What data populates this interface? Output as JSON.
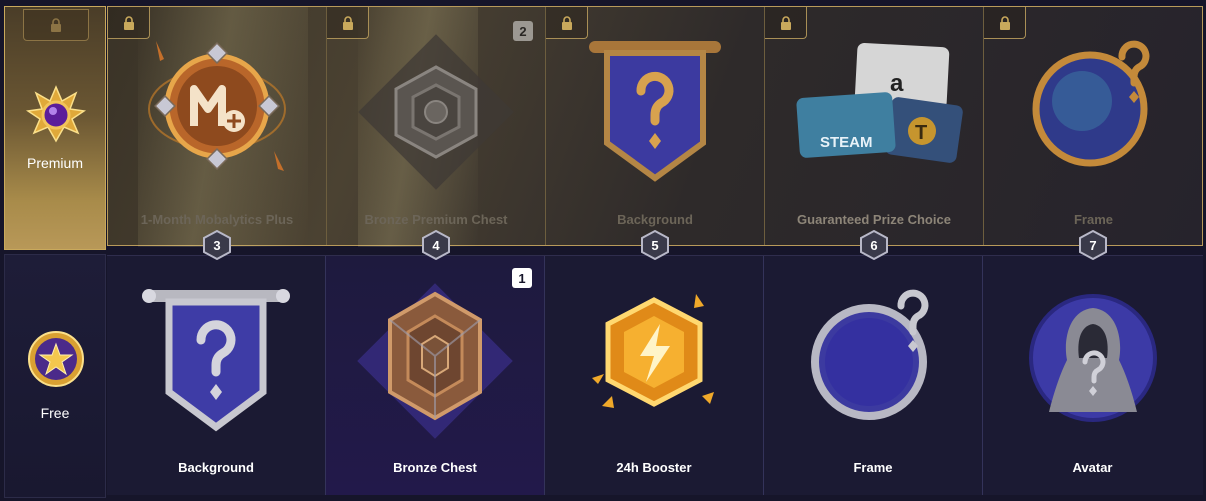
{
  "sidebar": {
    "premium": {
      "label": "Premium",
      "lock_icon": "lock-icon",
      "icon": "premium-crest-icon"
    },
    "free": {
      "label": "Free",
      "icon": "star-medal-icon"
    }
  },
  "levels": [
    "3",
    "4",
    "5",
    "6",
    "7"
  ],
  "premium_rewards": [
    {
      "name": "1-Month Mobalytics Plus",
      "locked": true,
      "icon": "mobalytics-plus-medallion"
    },
    {
      "name": "Bronze Premium Chest",
      "locked": true,
      "count": "2",
      "icon": "bronze-chest"
    },
    {
      "name": "Background",
      "locked": true,
      "icon": "banner-question"
    },
    {
      "name": "Guaranteed Prize Choice",
      "locked": true,
      "icon": "gift-cards",
      "card_labels": [
        "a",
        "STEAM",
        "T"
      ]
    },
    {
      "name": "Frame",
      "locked": true,
      "icon": "frame-question"
    }
  ],
  "free_rewards": [
    {
      "name": "Background",
      "icon": "banner-question"
    },
    {
      "name": "Bronze Chest",
      "count": "1",
      "icon": "bronze-chest"
    },
    {
      "name": "24h Booster",
      "icon": "lightning-hex"
    },
    {
      "name": "Frame",
      "icon": "frame-question"
    },
    {
      "name": "Avatar",
      "icon": "hooded-avatar"
    }
  ],
  "colors": {
    "gold_border": "#b89a5a",
    "free_bg": "#1b1a33",
    "booster_gold": "#f0a92a",
    "purple_blue": "#4a44a6"
  }
}
